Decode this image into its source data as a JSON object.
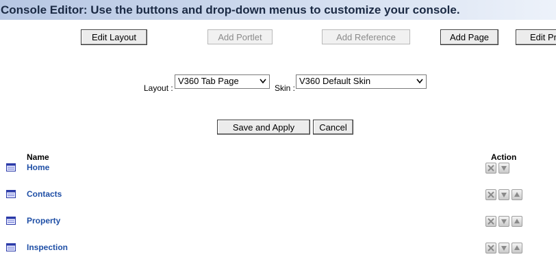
{
  "header": {
    "title": "Console Editor: Use the buttons and drop-down menus to customize your console."
  },
  "toolbar": {
    "edit_layout": "Edit Layout",
    "add_portlet": "Add Portlet",
    "add_reference": "Add Reference",
    "add_page": "Add Page",
    "edit_partial": "Edit Pr"
  },
  "form": {
    "layout_label": "Layout :",
    "layout_value": "V360 Tab Page",
    "skin_label": "Skin :",
    "skin_value": "V360 Default Skin"
  },
  "actions": {
    "save_apply": "Save and Apply",
    "cancel": "Cancel"
  },
  "table": {
    "headers": {
      "name": "Name",
      "action": "Action"
    },
    "rows": [
      {
        "name": "Home"
      },
      {
        "name": "Contacts"
      },
      {
        "name": "Property"
      },
      {
        "name": "Inspection"
      }
    ]
  },
  "colors": {
    "link": "#1f4fa6",
    "header_bg": "#c7d4ea"
  }
}
